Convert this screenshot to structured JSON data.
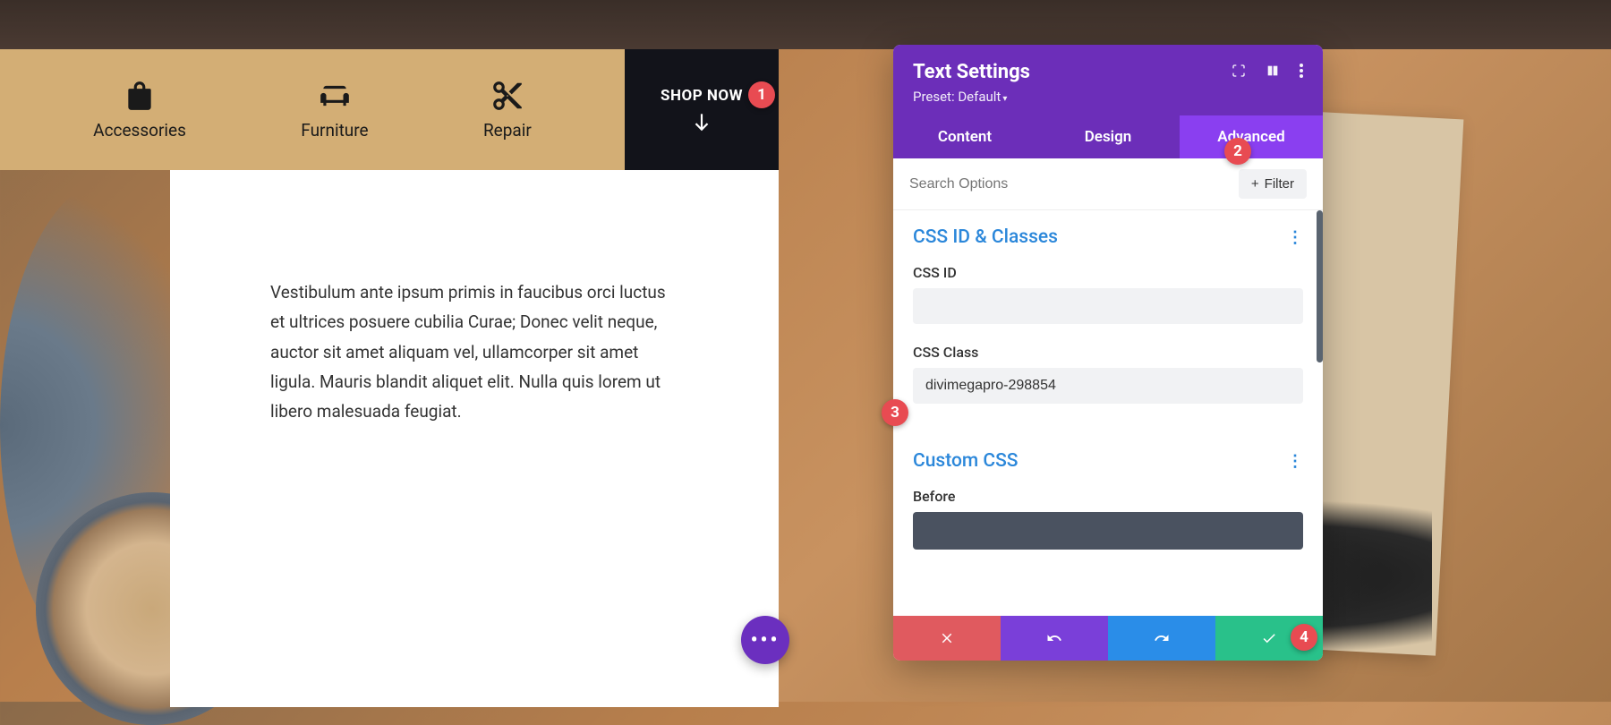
{
  "menu": {
    "items": [
      {
        "label": "Accessories",
        "icon": "bag"
      },
      {
        "label": "Furniture",
        "icon": "couch"
      },
      {
        "label": "Repair",
        "icon": "scissors"
      }
    ],
    "shop_now": "SHOP NOW"
  },
  "content": {
    "body": "Vestibulum ante ipsum primis in faucibus orci luctus et ultrices posuere cubilia Curae; Donec velit neque, auctor sit amet aliquam vel, ullamcorper sit amet ligula. Mauris blandit aliquet elit. Nulla quis lorem ut libero malesuada feugiat."
  },
  "panel": {
    "title": "Text Settings",
    "preset_label": "Preset: Default",
    "tabs": {
      "content": "Content",
      "design": "Design",
      "advanced": "Advanced"
    },
    "search_placeholder": "Search Options",
    "filter_label": "Filter",
    "sections": {
      "css_id_classes": {
        "title": "CSS ID & Classes",
        "css_id_label": "CSS ID",
        "css_id_value": "",
        "css_class_label": "CSS Class",
        "css_class_value": "divimegapro-298854"
      },
      "custom_css": {
        "title": "Custom CSS",
        "before_label": "Before"
      }
    }
  },
  "badges": [
    "1",
    "2",
    "3",
    "4"
  ],
  "colors": {
    "menu_bg": "#d3ae75",
    "shop_bg": "#12131a",
    "panel_header": "#6c2eb9",
    "tab_active": "#8a3ff0",
    "section_title": "#2b87da",
    "badge": "#e84b52",
    "fab": "#6b2fbf",
    "cancel": "#e05a5f",
    "undo": "#7a3fd9",
    "redo": "#2a8de8",
    "save": "#29c18a"
  }
}
